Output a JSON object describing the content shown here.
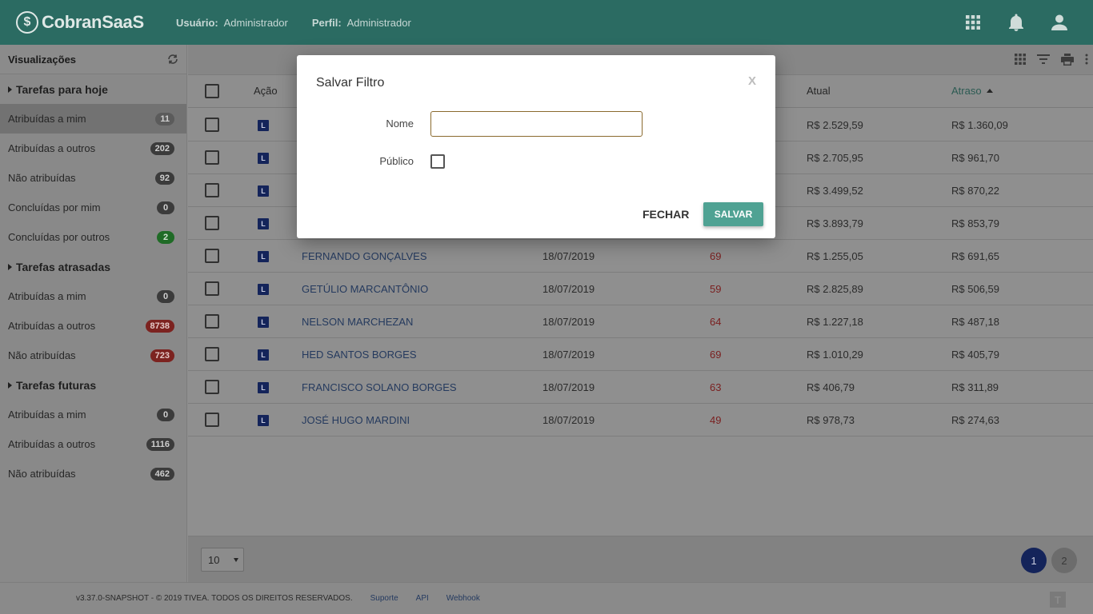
{
  "header": {
    "logo_symbol": "$",
    "logo_text": "CobranSaaS",
    "user_label": "Usuário:",
    "user_value": "Administrador",
    "profile_label": "Perfil:",
    "profile_value": "Administrador",
    "icons": [
      "apps-grid-icon",
      "bell-icon",
      "user-icon"
    ]
  },
  "sidebar": {
    "title": "Visualizações",
    "groups": [
      {
        "label": "Tarefas para hoje",
        "items": [
          {
            "label": "Atribuídas a mim",
            "count": "11",
            "style": "active"
          },
          {
            "label": "Atribuídas a outros",
            "count": "202",
            "style": "dark"
          },
          {
            "label": "Não atribuídas",
            "count": "92",
            "style": "dark"
          },
          {
            "label": "Concluídas por mim",
            "count": "0",
            "style": "dark"
          },
          {
            "label": "Concluídas por outros",
            "count": "2",
            "style": "green"
          }
        ]
      },
      {
        "label": "Tarefas atrasadas",
        "items": [
          {
            "label": "Atribuídas a mim",
            "count": "0",
            "style": "dark"
          },
          {
            "label": "Atribuídas a outros",
            "count": "8738",
            "style": "red"
          },
          {
            "label": "Não atribuídas",
            "count": "723",
            "style": "red"
          }
        ]
      },
      {
        "label": "Tarefas futuras",
        "items": [
          {
            "label": "Atribuídas a mim",
            "count": "0",
            "style": "dark"
          },
          {
            "label": "Atribuídas a outros",
            "count": "1116",
            "style": "dark"
          },
          {
            "label": "Não atribuídas",
            "count": "462",
            "style": "dark"
          }
        ]
      }
    ]
  },
  "table": {
    "columns": {
      "action": "Ação",
      "current": "Atual",
      "delay": "Atraso"
    },
    "action_badge": "L",
    "rows": [
      {
        "name": "",
        "date": "",
        "days": "",
        "current": "R$ 2.529,59",
        "delay": "R$ 1.360,09"
      },
      {
        "name": "",
        "date": "",
        "days": "",
        "current": "R$ 2.705,95",
        "delay": "R$ 961,70"
      },
      {
        "name": "",
        "date": "",
        "days": "",
        "current": "R$ 3.499,52",
        "delay": "R$ 870,22"
      },
      {
        "name": "",
        "date": "",
        "days": "",
        "current": "R$ 3.893,79",
        "delay": "R$ 853,79"
      },
      {
        "name": "FERNANDO GONÇALVES",
        "date": "18/07/2019",
        "days": "69",
        "current": "R$ 1.255,05",
        "delay": "R$ 691,65"
      },
      {
        "name": "GETÚLIO MARCANTÔNIO",
        "date": "18/07/2019",
        "days": "59",
        "current": "R$ 2.825,89",
        "delay": "R$ 506,59"
      },
      {
        "name": "NELSON MARCHEZAN",
        "date": "18/07/2019",
        "days": "64",
        "current": "R$ 1.227,18",
        "delay": "R$ 487,18"
      },
      {
        "name": "HED SANTOS BORGES",
        "date": "18/07/2019",
        "days": "69",
        "current": "R$ 1.010,29",
        "delay": "R$ 405,79"
      },
      {
        "name": "FRANCISCO SOLANO BORGES",
        "date": "18/07/2019",
        "days": "63",
        "current": "R$ 406,79",
        "delay": "R$ 311,89"
      },
      {
        "name": "JOSÉ HUGO MARDINI",
        "date": "18/07/2019",
        "days": "49",
        "current": "R$ 978,73",
        "delay": "R$ 274,63"
      }
    ]
  },
  "pager": {
    "page_size": "10",
    "pages": [
      "1",
      "2"
    ],
    "current": "1"
  },
  "footer": {
    "copyright": "v3.37.0-SNAPSHOT - © 2019 TIVEA. TODOS OS DIREITOS RESERVADOS.",
    "links": [
      "Suporte",
      "API",
      "Webhook"
    ],
    "logo_letter": "T"
  },
  "modal": {
    "title": "Salvar Filtro",
    "close_glyph": "X",
    "name_label": "Nome",
    "name_value": "",
    "public_label": "Público",
    "cancel_label": "FECHAR",
    "save_label": "SALVAR"
  }
}
